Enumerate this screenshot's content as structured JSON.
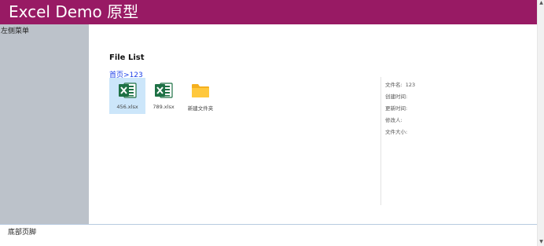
{
  "app": {
    "title": "Excel Demo 原型",
    "brand_color": "#981a64"
  },
  "sidebar": {
    "label": "左侧菜单"
  },
  "main": {
    "title": "File List",
    "breadcrumb": [
      "首页",
      ">",
      "123"
    ]
  },
  "files": [
    {
      "name": "456.xlsx",
      "icon": "excel-icon",
      "selected": true
    },
    {
      "name": "789.xlsx",
      "icon": "excel-icon",
      "selected": false
    },
    {
      "name": "新建文件夹",
      "icon": "folder-icon",
      "selected": false
    }
  ],
  "properties": [
    {
      "label": "文件名:",
      "value": "123"
    },
    {
      "label": "创建时间:",
      "value": ""
    },
    {
      "label": "更新时间:",
      "value": ""
    },
    {
      "label": "修改人:",
      "value": ""
    },
    {
      "label": "文件大小:",
      "value": ""
    }
  ],
  "footer": {
    "label": "底部页脚"
  },
  "colors": {
    "excel_green": "#1e7145",
    "folder_yellow": "#ffc02b",
    "link_blue": "#1a3ee8",
    "selection": "#cce6fa"
  }
}
